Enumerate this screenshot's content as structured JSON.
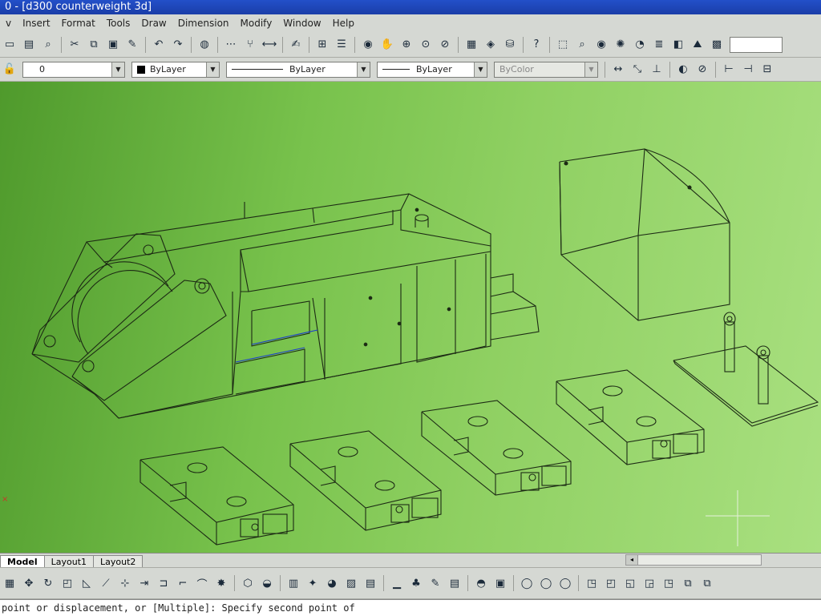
{
  "window": {
    "title": "0 - [d300 counterweight 3d]"
  },
  "menu": [
    "v",
    "Insert",
    "Format",
    "Tools",
    "Draw",
    "Dimension",
    "Modify",
    "Window",
    "Help"
  ],
  "properties": {
    "layer": "0",
    "color": "ByLayer",
    "linetype": "ByLayer",
    "lineweight": "ByLayer",
    "plotstyle": "ByColor"
  },
  "tabs": [
    "Model",
    "Layout1",
    "Layout2"
  ],
  "active_tab": "Model",
  "command_line": "point or displacement, or [Multiple]: Specify second point of"
}
